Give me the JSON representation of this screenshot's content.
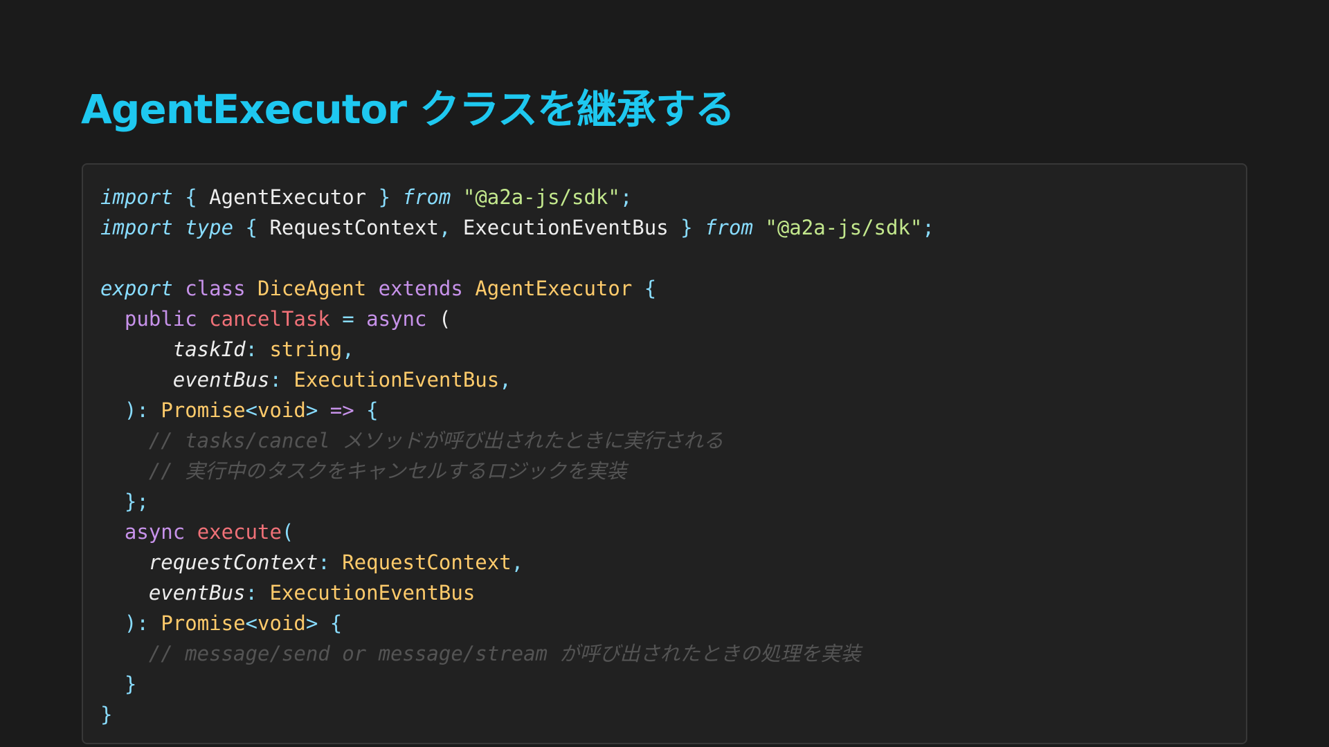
{
  "slide": {
    "title": "AgentExecutor クラスを継承する"
  },
  "code": {
    "language": "typescript",
    "lines": [
      [
        [
          "kw-i",
          "import"
        ],
        [
          "plain",
          " "
        ],
        [
          "pun",
          "{"
        ],
        [
          "plain",
          " AgentExecutor "
        ],
        [
          "pun",
          "}"
        ],
        [
          "plain",
          " "
        ],
        [
          "kw-i",
          "from"
        ],
        [
          "plain",
          " "
        ],
        [
          "str",
          "\"@a2a-js/sdk\""
        ],
        [
          "pun",
          ";"
        ]
      ],
      [
        [
          "kw-i",
          "import"
        ],
        [
          "plain",
          " "
        ],
        [
          "kw-i",
          "type"
        ],
        [
          "plain",
          " "
        ],
        [
          "pun",
          "{"
        ],
        [
          "plain",
          " RequestContext"
        ],
        [
          "pun",
          ","
        ],
        [
          "plain",
          " ExecutionEventBus "
        ],
        [
          "pun",
          "}"
        ],
        [
          "plain",
          " "
        ],
        [
          "kw-i",
          "from"
        ],
        [
          "plain",
          " "
        ],
        [
          "str",
          "\"@a2a-js/sdk\""
        ],
        [
          "pun",
          ";"
        ]
      ],
      [],
      [
        [
          "kw-i",
          "export"
        ],
        [
          "plain",
          " "
        ],
        [
          "kw-p",
          "class"
        ],
        [
          "plain",
          " "
        ],
        [
          "typ",
          "DiceAgent"
        ],
        [
          "plain",
          " "
        ],
        [
          "kw-p",
          "extends"
        ],
        [
          "plain",
          " "
        ],
        [
          "typ",
          "AgentExecutor"
        ],
        [
          "plain",
          " "
        ],
        [
          "pun",
          "{"
        ]
      ],
      [
        [
          "plain",
          "  "
        ],
        [
          "kw-p",
          "public"
        ],
        [
          "plain",
          " "
        ],
        [
          "fn",
          "cancelTask"
        ],
        [
          "plain",
          " "
        ],
        [
          "pun",
          "="
        ],
        [
          "plain",
          " "
        ],
        [
          "kw-p",
          "async"
        ],
        [
          "plain",
          " ("
        ]
      ],
      [
        [
          "plain",
          "      "
        ],
        [
          "param",
          "taskId"
        ],
        [
          "pun",
          ":"
        ],
        [
          "plain",
          " "
        ],
        [
          "typ",
          "string"
        ],
        [
          "pun",
          ","
        ]
      ],
      [
        [
          "plain",
          "      "
        ],
        [
          "param",
          "eventBus"
        ],
        [
          "pun",
          ":"
        ],
        [
          "plain",
          " "
        ],
        [
          "typ",
          "ExecutionEventBus"
        ],
        [
          "pun",
          ","
        ]
      ],
      [
        [
          "plain",
          "  "
        ],
        [
          "pun",
          "):"
        ],
        [
          "plain",
          " "
        ],
        [
          "typ",
          "Promise"
        ],
        [
          "pun",
          "<"
        ],
        [
          "typ",
          "void"
        ],
        [
          "pun",
          ">"
        ],
        [
          "plain",
          " "
        ],
        [
          "kw-p",
          "=>"
        ],
        [
          "plain",
          " "
        ],
        [
          "pun",
          "{"
        ]
      ],
      [
        [
          "plain",
          "    "
        ],
        [
          "cmt",
          "// tasks/cancel メソッドが呼び出されたときに実行される"
        ]
      ],
      [
        [
          "plain",
          "    "
        ],
        [
          "cmt",
          "// 実行中のタスクをキャンセルするロジックを実装"
        ]
      ],
      [
        [
          "plain",
          "  "
        ],
        [
          "pun",
          "};"
        ]
      ],
      [
        [
          "plain",
          "  "
        ],
        [
          "kw-p",
          "async"
        ],
        [
          "plain",
          " "
        ],
        [
          "fn",
          "execute"
        ],
        [
          "pun",
          "("
        ]
      ],
      [
        [
          "plain",
          "    "
        ],
        [
          "param",
          "requestContext"
        ],
        [
          "pun",
          ":"
        ],
        [
          "plain",
          " "
        ],
        [
          "typ",
          "RequestContext"
        ],
        [
          "pun",
          ","
        ]
      ],
      [
        [
          "plain",
          "    "
        ],
        [
          "param",
          "eventBus"
        ],
        [
          "pun",
          ":"
        ],
        [
          "plain",
          " "
        ],
        [
          "typ",
          "ExecutionEventBus"
        ]
      ],
      [
        [
          "plain",
          "  "
        ],
        [
          "pun",
          "):"
        ],
        [
          "plain",
          " "
        ],
        [
          "typ",
          "Promise"
        ],
        [
          "pun",
          "<"
        ],
        [
          "typ",
          "void"
        ],
        [
          "pun",
          ">"
        ],
        [
          "plain",
          " "
        ],
        [
          "pun",
          "{"
        ]
      ],
      [
        [
          "plain",
          "    "
        ],
        [
          "cmt",
          "// message/send or message/stream が呼び出されたときの処理を実装"
        ]
      ],
      [
        [
          "plain",
          "  "
        ],
        [
          "pun",
          "}"
        ]
      ],
      [
        [
          "pun",
          "}"
        ]
      ]
    ]
  }
}
